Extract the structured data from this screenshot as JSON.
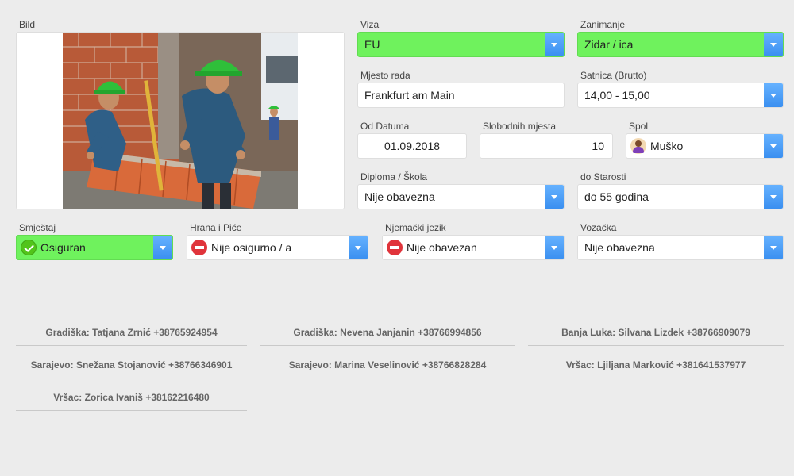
{
  "image": {
    "label": "Bild"
  },
  "fields": {
    "viza": {
      "label": "Viza",
      "value": "EU"
    },
    "zanimanje": {
      "label": "Zanimanje",
      "value": "Zidar / ica"
    },
    "mjesto_rada": {
      "label": "Mjesto rada",
      "value": "Frankfurt am Main"
    },
    "satnica": {
      "label": "Satnica (Brutto)",
      "value": "14,00 - 15,00"
    },
    "od_datuma": {
      "label": "Od Datuma",
      "value": "01.09.2018"
    },
    "slobodnih_mjesta": {
      "label": "Slobodnih mjesta",
      "value": "10"
    },
    "spol": {
      "label": "Spol",
      "value": "Muško"
    },
    "diploma": {
      "label": "Diploma / Škola",
      "value": "Nije obavezna"
    },
    "do_starosti": {
      "label": "do Starosti",
      "value": "do 55 godina"
    },
    "smjestaj": {
      "label": "Smještaj",
      "value": "Osiguran"
    },
    "hrana": {
      "label": "Hrana i Piće",
      "value": "Nije osigurno / a"
    },
    "njemacki": {
      "label": "Njemački jezik",
      "value": "Nije obavezan"
    },
    "vozacka": {
      "label": "Vozačka",
      "value": "Nije obavezna"
    }
  },
  "contacts": [
    "Gradiška: Tatjana Zrnić +38765924954",
    "Gradiška: Nevena Janjanin +38766994856",
    "Banja Luka: Silvana Lizdek +38766909079",
    "Sarajevo: Snežana Stojanović +38766346901",
    "Sarajevo: Marina Veselinović +38766828284",
    "Vršac: Ljiljana Marković +381641537977",
    "Vršac: Zorica Ivaniš +38162216480"
  ],
  "colors": {
    "selected_green": "#6ff25d",
    "dropdown_blue": "#3a8ff0",
    "ok_icon": "#52c41a",
    "no_icon": "#e0343b"
  },
  "icons": {
    "dropdown": "chevron-down-icon",
    "ok": "check-circle-icon",
    "no": "minus-circle-icon",
    "user": "male-user-icon"
  }
}
